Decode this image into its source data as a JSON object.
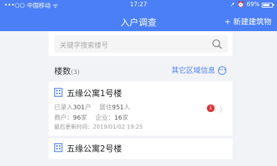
{
  "status_bar": {
    "signal": "•••○○",
    "carrier": "中国移动",
    "wifi": "ᯤ",
    "time": "17:27",
    "battery_pct": "69%",
    "battery_level": 0.69
  },
  "nav": {
    "title": "入户调查",
    "action": "+ 新建建筑物"
  },
  "search": {
    "placeholder": "关键字搜索楼号"
  },
  "list_header": {
    "label": "楼数",
    "count": "(3)",
    "other_area": "其它区域信息"
  },
  "buildings": [
    {
      "name": "五缘公寓1号楼",
      "recorded_label": "已录入",
      "recorded_value": "301",
      "recorded_unit": "户",
      "residents_label": "居住",
      "residents_value": "951",
      "residents_unit": "人",
      "merchants_label": "商户：",
      "merchants_value": "96",
      "merchants_unit": "家",
      "companies_label": "企业：",
      "companies_value": "16",
      "companies_unit": "家",
      "updated_label": "最后更新时间：",
      "updated_value": "2019/01/02  19:25",
      "badge": "1"
    },
    {
      "name": "五缘公寓2号楼"
    }
  ],
  "colors": {
    "primary": "#4a7ff7",
    "badge": "#e83030"
  }
}
